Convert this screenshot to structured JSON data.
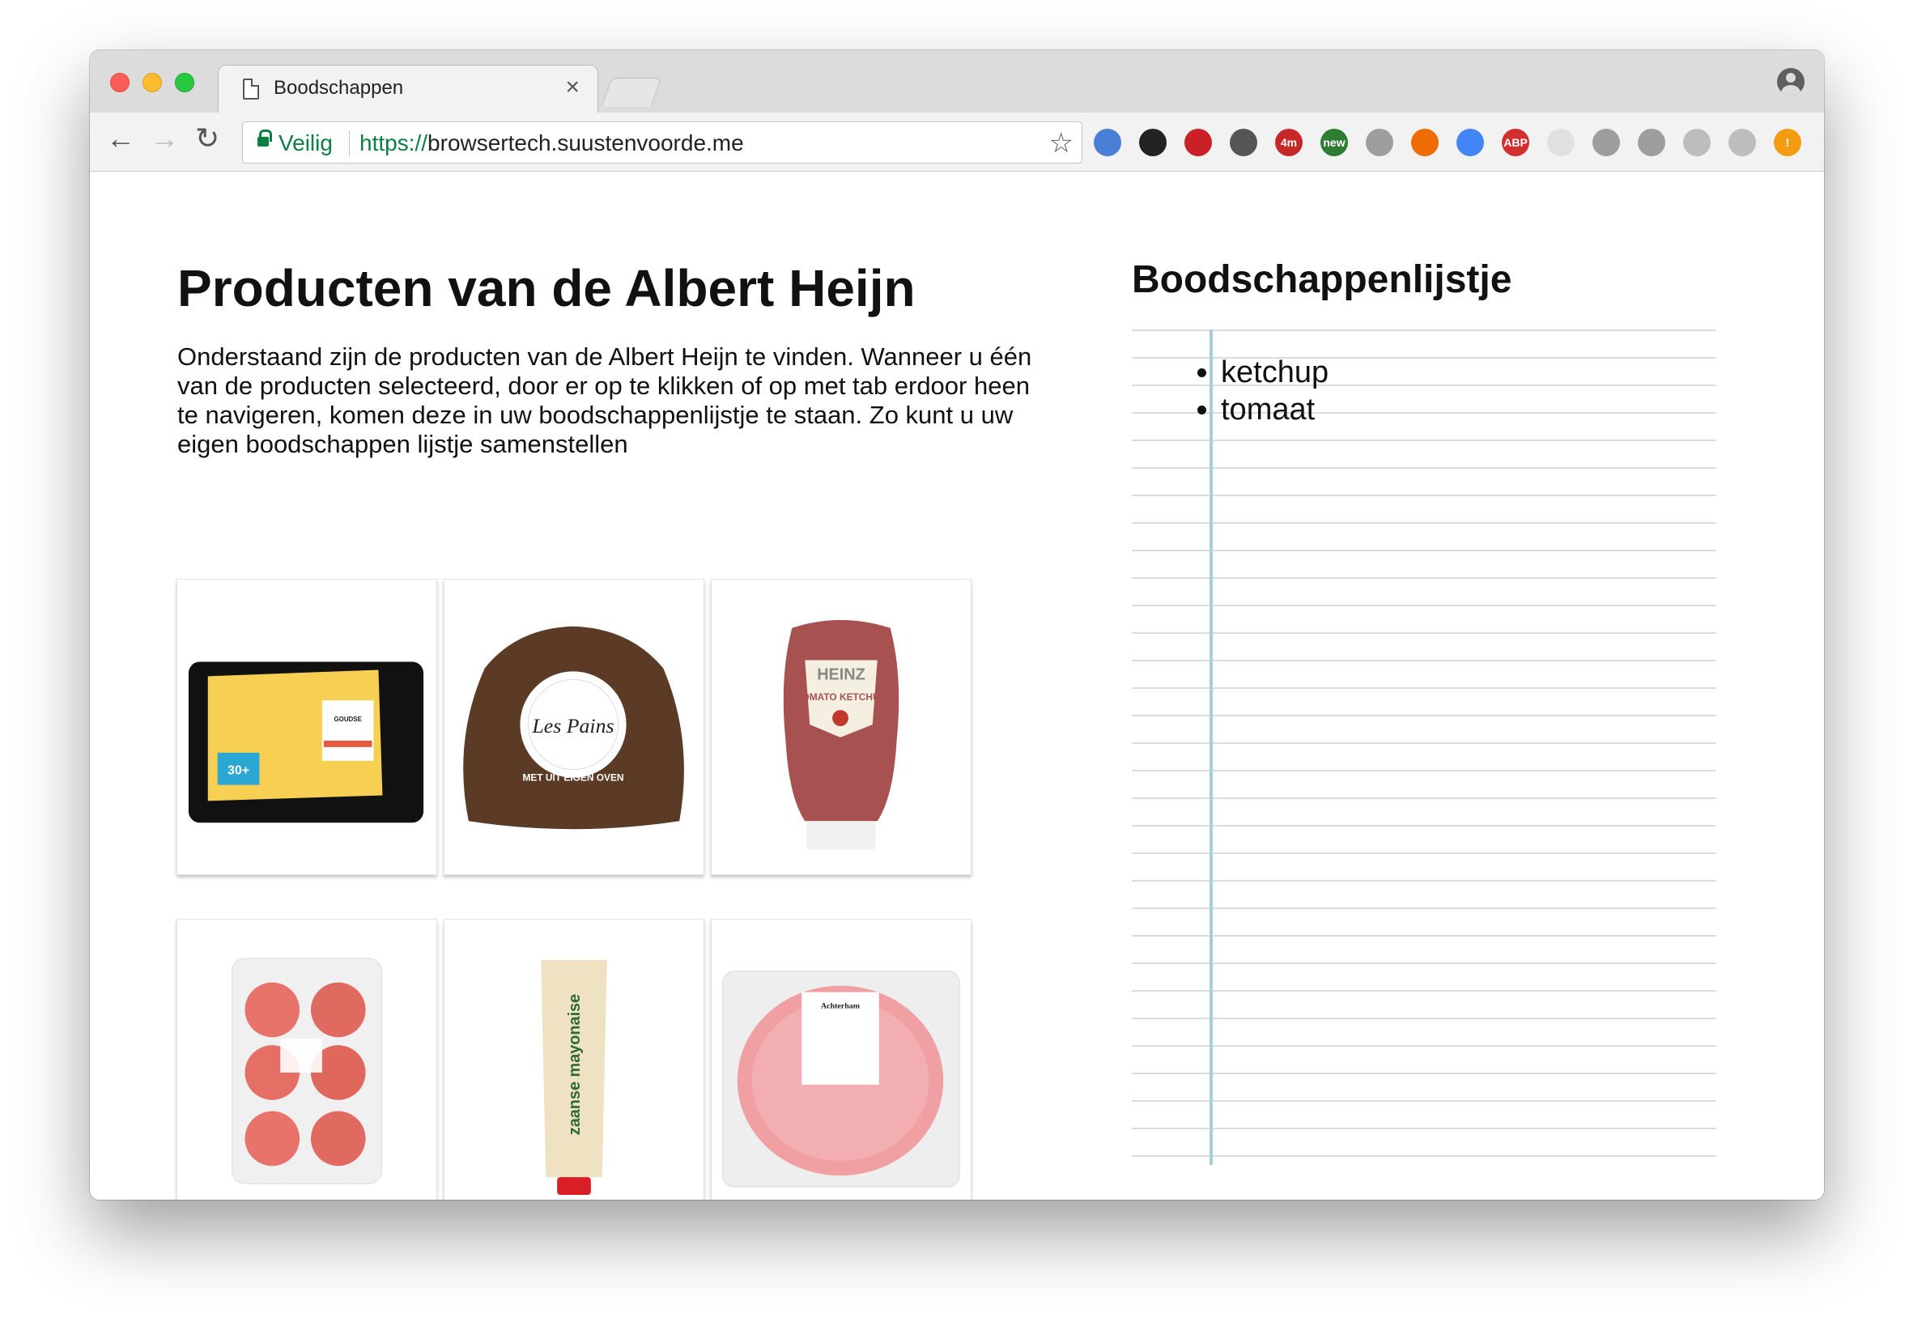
{
  "browser": {
    "tab_title": "Boodschappen",
    "tab_close": "×",
    "secure_label": "Veilig",
    "url_scheme": "https://",
    "url_host": "browsertech.suustenvoorde.me",
    "extensions": [
      {
        "name": "eye-extension-icon",
        "color": "#4a7fd8"
      },
      {
        "name": "colorpicker-extension-icon",
        "color": "#222222"
      },
      {
        "name": "pinterest-extension-icon",
        "color": "#cb2027"
      },
      {
        "name": "move-extension-icon",
        "color": "#555555"
      },
      {
        "name": "timer-extension-icon",
        "color": "#c62828",
        "label": "4m"
      },
      {
        "name": "new-extension-icon",
        "color": "#2e7d32",
        "label": "new"
      },
      {
        "name": "skype-extension-icon",
        "color": "#9e9e9e"
      },
      {
        "name": "fire-extension-icon",
        "color": "#ef6c00"
      },
      {
        "name": "translate-extension-icon",
        "color": "#4285f4"
      },
      {
        "name": "adblock-extension-icon",
        "color": "#d32f2f",
        "label": "ABP"
      },
      {
        "name": "amazon-extension-icon",
        "color": "#e0e0e0"
      },
      {
        "name": "block-extension-icon",
        "color": "#9e9e9e"
      },
      {
        "name": "qr-extension-icon",
        "color": "#9e9e9e"
      },
      {
        "name": "settings-extension-icon",
        "color": "#bdbdbd"
      },
      {
        "name": "dmg-extension-icon",
        "color": "#bdbdbd"
      },
      {
        "name": "alert-extension-icon",
        "color": "#f39c12",
        "label": "!"
      }
    ]
  },
  "page": {
    "title": "Producten van de Albert Heijn",
    "intro": "Onderstaand zijn de producten van de Albert Heijn te vinden. Wanneer u één van de producten selecteerd, door er op te klikken of op met tab erdoor heen te navigeren, komen deze in uw boodschappenlijstje te staan. Zo kunt u uw eigen boodschappen lijstje samenstellen"
  },
  "products": [
    {
      "name": "kaas",
      "package_text": "GOUDSE",
      "badge": "30+"
    },
    {
      "name": "brood",
      "package_text": "Les Pains",
      "ring_text": "MET UIT EIGEN OVEN"
    },
    {
      "name": "ketchup",
      "package_text": "HEINZ",
      "sub_text": "TOMATO KETCHUP"
    },
    {
      "name": "tomaat"
    },
    {
      "name": "mayonaise",
      "package_text": "zaanse mayonaise"
    },
    {
      "name": "ham",
      "package_text": "Achterham"
    }
  ],
  "shopping_list": {
    "title": "Boodschappenlijstje",
    "items": [
      "ketchup",
      "tomaat"
    ]
  }
}
